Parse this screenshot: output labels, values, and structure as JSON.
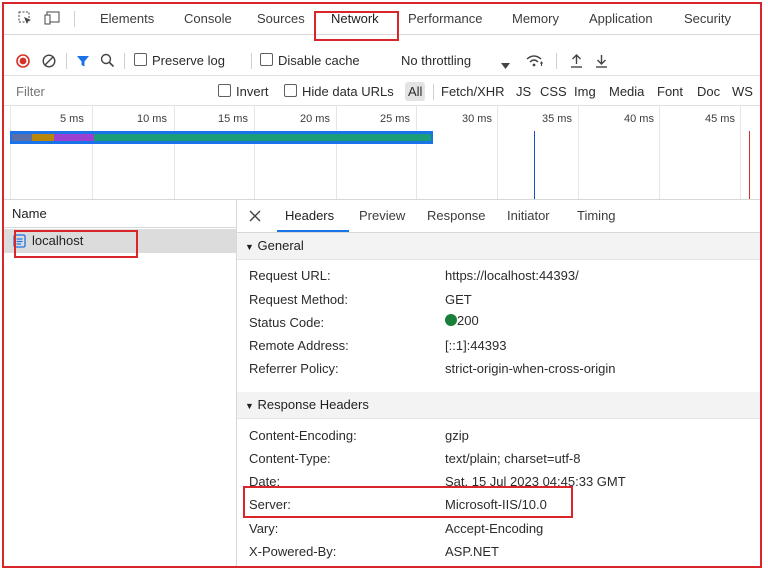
{
  "tabs": [
    "Elements",
    "Console",
    "Sources",
    "Network",
    "Performance",
    "Memory",
    "Application",
    "Security"
  ],
  "toolbar": {
    "preserve_log": "Preserve log",
    "disable_cache": "Disable cache",
    "throttling": "No throttling"
  },
  "filterbar": {
    "placeholder": "Filter",
    "invert": "Invert",
    "hide_data_urls": "Hide data URLs",
    "types": [
      "All",
      "Fetch/XHR",
      "JS",
      "CSS",
      "Img",
      "Media",
      "Font",
      "Doc",
      "WS"
    ]
  },
  "timeline": {
    "ticks": [
      "5 ms",
      "10 ms",
      "15 ms",
      "20 ms",
      "25 ms",
      "30 ms",
      "35 ms",
      "40 ms",
      "45 ms"
    ]
  },
  "requests": {
    "column": "Name",
    "items": [
      "localhost"
    ]
  },
  "details": {
    "tabs": [
      "Headers",
      "Preview",
      "Response",
      "Initiator",
      "Timing"
    ],
    "general": {
      "title": "General",
      "rows": [
        {
          "k": "Request URL:",
          "v": "https://localhost:44393/"
        },
        {
          "k": "Request Method:",
          "v": "GET"
        },
        {
          "k": "Status Code:",
          "v": "200"
        },
        {
          "k": "Remote Address:",
          "v": "[::1]:44393"
        },
        {
          "k": "Referrer Policy:",
          "v": "strict-origin-when-cross-origin"
        }
      ]
    },
    "response": {
      "title": "Response Headers",
      "rows": [
        {
          "k": "Content-Encoding:",
          "v": "gzip"
        },
        {
          "k": "Content-Type:",
          "v": "text/plain; charset=utf-8"
        },
        {
          "k": "Date:",
          "v": "Sat, 15 Jul 2023 04:45:33 GMT"
        },
        {
          "k": "Server:",
          "v": "Microsoft-IIS/10.0"
        },
        {
          "k": "Vary:",
          "v": "Accept-Encoding"
        },
        {
          "k": "X-Powered-By:",
          "v": "ASP.NET"
        }
      ]
    }
  },
  "colors": {
    "accent": "#1a73e8",
    "highlight": "#d9262b",
    "status_ok": "#188038",
    "record": "#d93025"
  },
  "icons": [
    "inspect-icon",
    "device-toolbar-icon",
    "record-icon",
    "clear-icon",
    "filter-icon",
    "search-icon",
    "wifi-icon",
    "upload-icon",
    "download-icon",
    "close-icon",
    "document-icon",
    "triangle-down-icon"
  ]
}
